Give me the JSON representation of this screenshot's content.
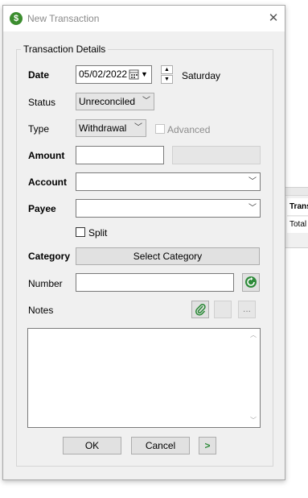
{
  "dialog": {
    "title": "New Transaction",
    "app_icon_glyph": "$",
    "close_glyph": "✕"
  },
  "group_title": "Transaction Details",
  "labels": {
    "date": "Date",
    "status": "Status",
    "type": "Type",
    "amount": "Amount",
    "account": "Account",
    "payee": "Payee",
    "category": "Category",
    "number": "Number",
    "notes": "Notes"
  },
  "date": {
    "value": "05/02/2022",
    "day_of_week": "Saturday"
  },
  "status": {
    "selected": "Unreconciled"
  },
  "type": {
    "selected": "Withdrawal",
    "advanced_label": "Advanced",
    "advanced_checked": false,
    "advanced_enabled": false
  },
  "amount": {
    "value": ""
  },
  "account": {
    "value": ""
  },
  "payee": {
    "value": ""
  },
  "split": {
    "label": "Split",
    "checked": false
  },
  "category": {
    "button_label": "Select Category"
  },
  "number": {
    "value": ""
  },
  "notes": {
    "value": "",
    "more_label": "..."
  },
  "buttons": {
    "ok": "OK",
    "cancel": "Cancel",
    "next_glyph": ">"
  },
  "icons": {
    "calendar": "calendar-icon",
    "refresh": "refresh-number-icon",
    "attach": "paperclip-icon"
  },
  "background_window": {
    "header": "Trans",
    "cell": "Total"
  },
  "colors": {
    "accent_green": "#2e8b3a",
    "app_icon": "#3c8d2f"
  }
}
